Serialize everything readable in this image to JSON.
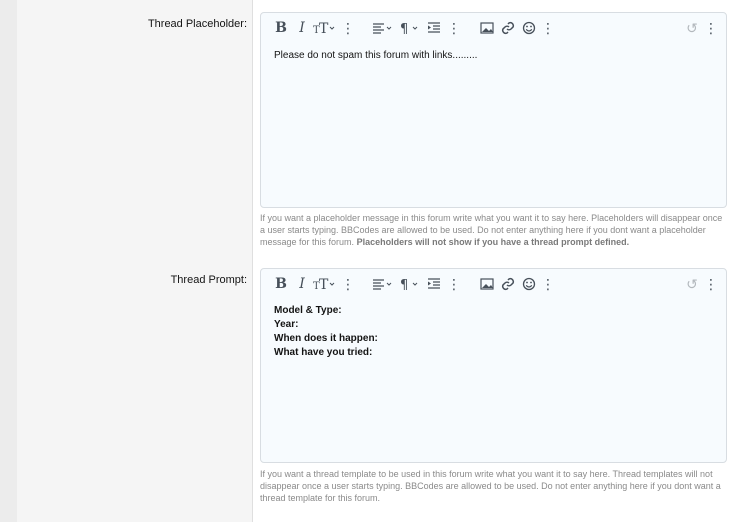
{
  "placeholder_field": {
    "label": "Thread Placeholder:",
    "content": "Please do not spam this forum with links.........",
    "help_text": "If you want a placeholder message in this forum write what you want it to say here. Placeholders will disappear once a user starts typing. BBCodes are allowed to be used. Do not enter anything here if you dont want a placeholder message for this forum.",
    "help_bold": "Placeholders will not show if you have a thread prompt defined."
  },
  "prompt_field": {
    "label": "Thread Prompt:",
    "lines": [
      "Model & Type:",
      "Year:",
      "When does it happen:",
      "What have you tried:"
    ],
    "help_text": "If you want a thread template to be used in this forum write what you want it to say here. Thread templates will not disappear once a user starts typing. BBCodes are allowed to be used. Do not enter anything here if you dont want a thread template for this forum."
  },
  "toolbar": {
    "bold": "B",
    "italic": "I",
    "text_size": "T",
    "more": "⋮",
    "paragraph": "¶",
    "undo": "↺"
  },
  "icons": [
    "bold-icon",
    "italic-icon",
    "text-size-icon",
    "more-icon",
    "align-icon",
    "paragraph-icon",
    "indent-icon",
    "image-icon",
    "link-icon",
    "smiley-icon",
    "undo-icon"
  ],
  "colors": {
    "editor_bg": "#f7fbfe",
    "editor_border": "#d8dde2",
    "toolbar_icon": "#47505a",
    "help_text": "#8a8a8a"
  }
}
